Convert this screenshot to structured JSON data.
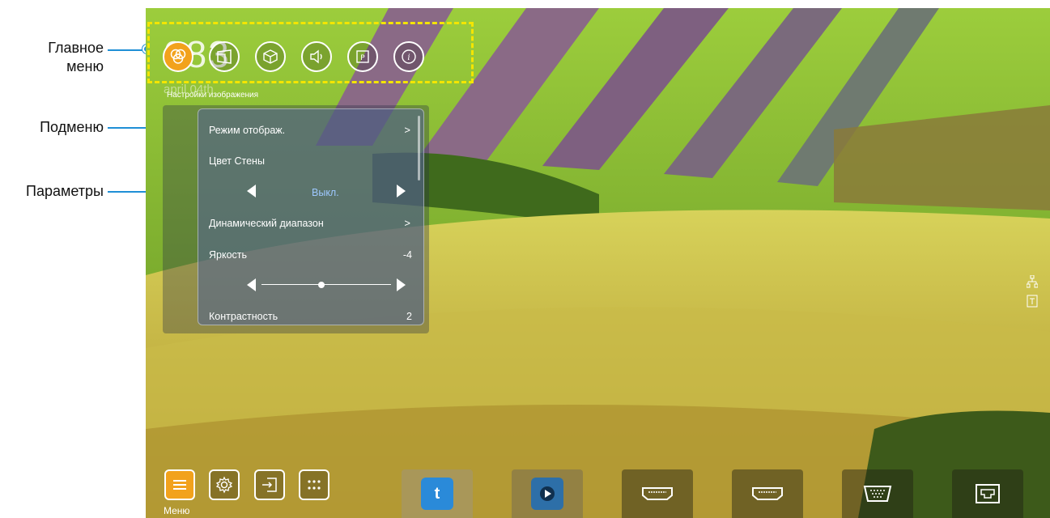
{
  "annotations": {
    "main_menu_line1": "Главное",
    "main_menu_line2": "меню",
    "submenu": "Подменю",
    "parameters": "Параметры",
    "accent_color": "#1f8fd6"
  },
  "screen": {
    "ghost_text": "083",
    "ghost_sub": "april 04th"
  },
  "main_menu": {
    "frame_color": "#f4e500",
    "items": [
      {
        "icon": "color-circles-icon",
        "active": true
      },
      {
        "icon": "screen-geometry-icon",
        "active": false
      },
      {
        "icon": "3d-cube-icon",
        "active": false
      },
      {
        "icon": "speaker-icon",
        "active": false
      },
      {
        "icon": "settings-p-icon",
        "active": false
      },
      {
        "icon": "info-icon",
        "active": false
      }
    ]
  },
  "osd": {
    "title": "Настройки изображения",
    "rows": {
      "display_mode": "Режим отображ.",
      "wall_color": "Цвет Стены",
      "wall_color_value": "Выкл.",
      "dynamic_range": "Динамический диапазон",
      "brightness": "Яркость",
      "brightness_value": "-4",
      "contrast": "Контрастность",
      "contrast_value": "2"
    },
    "brightness_slider_level": 0.46
  },
  "bottom_bar": {
    "menu_label": "Меню",
    "buttons": [
      {
        "icon": "menu-lines-icon",
        "active": true
      },
      {
        "icon": "gear-icon",
        "active": false
      },
      {
        "icon": "input-source-icon",
        "active": false
      },
      {
        "icon": "apps-grid-icon",
        "active": false
      }
    ],
    "tiles": [
      {
        "icon": "optoma-app-icon"
      },
      {
        "icon": "media-player-app-icon"
      },
      {
        "icon": "hdmi1-icon"
      },
      {
        "icon": "hdmi2-icon"
      },
      {
        "icon": "vga-icon"
      },
      {
        "icon": "lan-icon"
      }
    ]
  },
  "side_icons": [
    "network-icon",
    "usb-icon"
  ]
}
